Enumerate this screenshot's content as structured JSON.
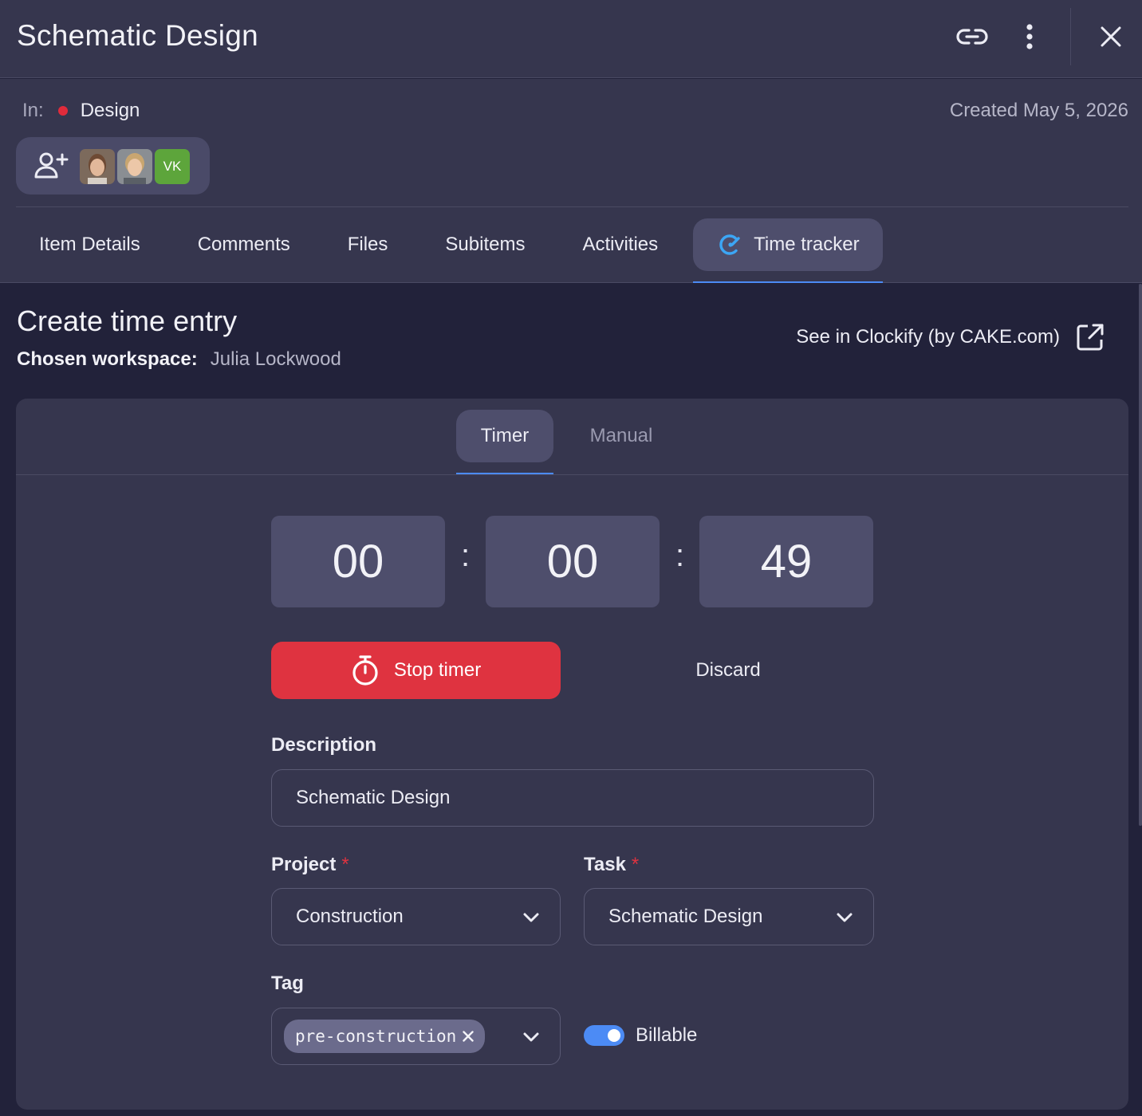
{
  "header": {
    "title": "Schematic Design",
    "icons": [
      "link-icon",
      "more-vertical-icon",
      "close-icon"
    ]
  },
  "info": {
    "in_label": "In:",
    "group_name": "Design",
    "group_color": "#e02b3b",
    "created": "Created May 5, 2026",
    "avatar_initials": "VK"
  },
  "tabs": [
    {
      "label": "Item Details"
    },
    {
      "label": "Comments"
    },
    {
      "label": "Files"
    },
    {
      "label": "Subitems"
    },
    {
      "label": "Activities"
    },
    {
      "label": "Time tracker",
      "active": true
    }
  ],
  "time_entry": {
    "title": "Create time entry",
    "workspace_label": "Chosen workspace:",
    "workspace_value": "Julia Lockwood",
    "clockify_link": "See in Clockify (by CAKE.com)"
  },
  "subtabs": {
    "timer": "Timer",
    "manual": "Manual"
  },
  "timer": {
    "hours": "00",
    "minutes": "00",
    "seconds": "49",
    "separator": ":"
  },
  "actions": {
    "stop": "Stop timer",
    "discard": "Discard"
  },
  "form": {
    "description_label": "Description",
    "description_value": "Schematic Design",
    "project_label": "Project",
    "project_value": "Construction",
    "task_label": "Task",
    "task_value": "Schematic Design",
    "required_mark": "*",
    "tag_label": "Tag",
    "tag_value": "pre-construction",
    "billable_label": "Billable",
    "billable_on": true
  },
  "colors": {
    "accent": "#4c8bf5",
    "danger": "#df3340",
    "panel": "#36364e",
    "background": "#22223a"
  }
}
